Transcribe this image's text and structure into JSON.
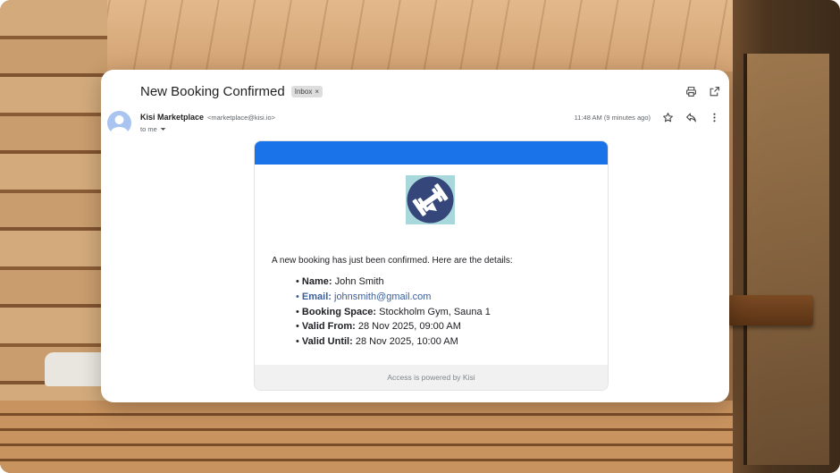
{
  "email": {
    "subject": "New Booking Confirmed",
    "label_chip": "Inbox",
    "label_chip_close": "×",
    "sender_name": "Kisi Marketplace",
    "sender_email": "<marketplace@kisi.io>",
    "recipient": "to me",
    "timestamp": "11:48 AM (9 minutes ago)",
    "icons": {
      "print": "printer-icon",
      "open_new": "open-in-new-icon",
      "star": "star-icon",
      "reply": "reply-icon",
      "more": "more-vert-icon",
      "dropdown": "caret-down-icon"
    }
  },
  "message": {
    "header_color": "#1a73e8",
    "intro": "A new booking has just been confirmed. Here are the details:",
    "details": [
      {
        "label": "Name:",
        "value": "John Smith"
      },
      {
        "label": "Email:",
        "value": "johnsmith@gmail.com"
      },
      {
        "label": "Booking Space:",
        "value": "Stockholm Gym, Sauna 1"
      },
      {
        "label": "Valid From:",
        "value": "28 Nov 2025, 09:00 AM"
      },
      {
        "label": "Valid Until:",
        "value": "28 Nov 2025, 10:00 AM"
      }
    ],
    "footer": "Access is powered by Kisi"
  }
}
